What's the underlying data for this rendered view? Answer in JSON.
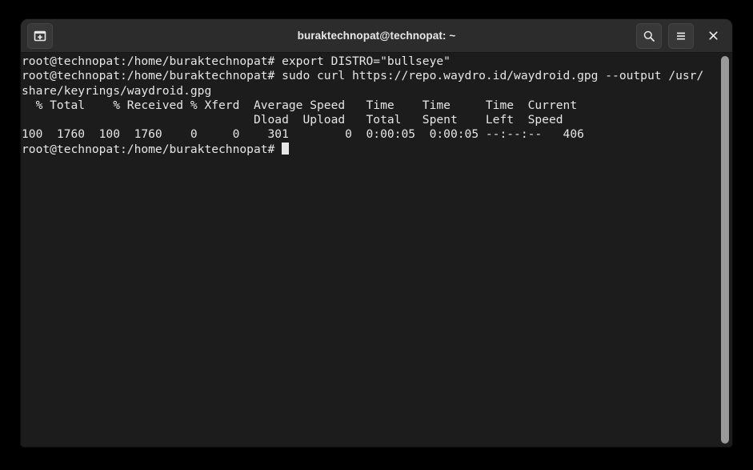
{
  "window": {
    "title": "buraktechnopat@technopat: ~",
    "colors": {
      "titlebar_bg": "#2c2c2c",
      "terminal_bg": "#1c1c1c",
      "text_fg": "#e6e6e6",
      "scrollbar": "#9a9a9a",
      "desktop_bg": "#000000"
    }
  },
  "titlebar": {
    "new_terminal_icon": "new-terminal-icon",
    "search_icon": "search-icon",
    "menu_icon": "hamburger-menu-icon",
    "close_icon": "close-icon"
  },
  "terminal": {
    "prompt": "root@technopat:/home/buraktechnopat# ",
    "lines": [
      "root@technopat:/home/buraktechnopat# export DISTRO=\"bullseye\"",
      "root@technopat:/home/buraktechnopat# sudo curl https://repo.waydro.id/waydroid.gpg --output /usr/",
      "share/keyrings/waydroid.gpg",
      "  % Total    % Received % Xferd  Average Speed   Time    Time     Time  Current",
      "                                 Dload  Upload   Total   Spent    Left  Speed",
      "100  1760  100  1760    0     0    301        0  0:00:05  0:00:05 --:--:--   406",
      "root@technopat:/home/buraktechnopat# "
    ],
    "commands": {
      "export_distro": "export DISTRO=\"bullseye\"",
      "curl_waydroid": "sudo curl https://repo.waydro.id/waydroid.gpg --output /usr/share/keyrings/waydroid.gpg"
    },
    "curl_progress": {
      "headers_row1": [
        "% Total",
        "% Received",
        "% Xferd",
        "Average Speed",
        "Time",
        "Time",
        "Time",
        "Current"
      ],
      "headers_row2": [
        "Dload",
        "Upload",
        "Total",
        "Spent",
        "Left",
        "Speed"
      ],
      "values": {
        "percent_total": "100",
        "total": "1760",
        "percent_received": "100",
        "received": "1760",
        "percent_xferd": "0",
        "xferd": "0",
        "average_dload": "301",
        "average_upload": "0",
        "time_total": "0:00:05",
        "time_spent": "0:00:05",
        "time_left": "--:--:--",
        "current_speed": "406"
      }
    },
    "cursor_visible": true
  },
  "scrollbar": {
    "position_percent": 100,
    "thumb_fraction": 100
  }
}
